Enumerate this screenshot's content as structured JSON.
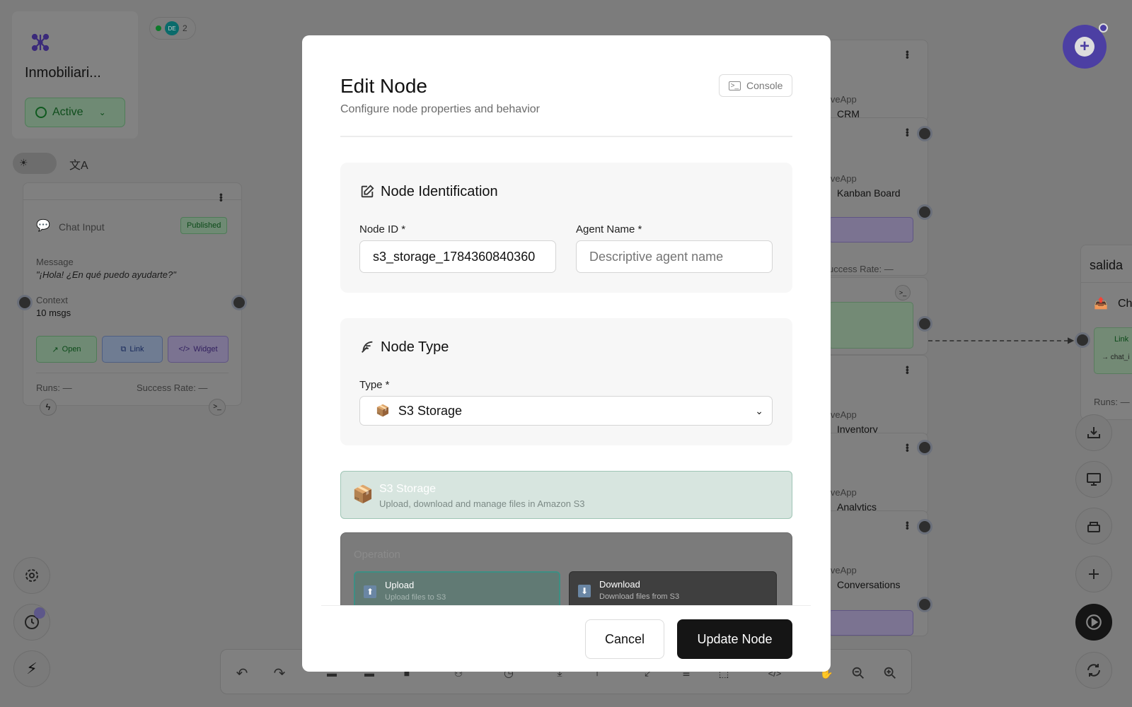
{
  "project": {
    "name": "Inmobiliari...",
    "status": "Active"
  },
  "presence": {
    "initials": "DE",
    "count": "2"
  },
  "chat_node": {
    "title": "Chat Input",
    "badge": "Published",
    "message_label": "Message",
    "message_value": "\"¡Hola! ¿En qué puedo ayudarte?\"",
    "context_label": "Context",
    "context_value": "10 msgs",
    "buttons": [
      "Open",
      "Link",
      "Widget"
    ],
    "runs": "Runs: —",
    "success_rate": "Success Rate: —"
  },
  "bg_nodes": [
    {
      "prefix": "iveApp",
      "name": "CRM"
    },
    {
      "prefix": "iveApp",
      "name": "Kanban Board"
    },
    {
      "prefix": "iveApp",
      "name": "Inventory"
    },
    {
      "prefix": "iveApp",
      "name": "Analytics"
    },
    {
      "prefix": "iveApp",
      "name": "Conversations"
    }
  ],
  "bg_success": "uccess Rate: —",
  "salida_node": {
    "title": "salida",
    "name": "Ch",
    "link": "Link",
    "sub": "→ chat_i",
    "runs": "Runs: —"
  },
  "modal": {
    "title": "Edit Node",
    "subtitle": "Configure node properties and behavior",
    "console_label": "Console",
    "identification": {
      "title": "Node Identification",
      "node_id_label": "Node ID *",
      "node_id_value": "s3_storage_1784360840360",
      "agent_name_label": "Agent Name *",
      "agent_name_placeholder": "Descriptive agent name"
    },
    "node_type": {
      "title": "Node Type",
      "type_label": "Type *",
      "selected": "S3 Storage"
    },
    "info_card": {
      "title": "S3 Storage",
      "desc": "Upload, download and manage files in Amazon S3"
    },
    "operation": {
      "label": "Operation",
      "options": [
        {
          "title": "Upload",
          "desc": "Upload files to S3"
        },
        {
          "title": "Download",
          "desc": "Download files from S3"
        }
      ]
    },
    "cancel_label": "Cancel",
    "update_label": "Update Node"
  }
}
